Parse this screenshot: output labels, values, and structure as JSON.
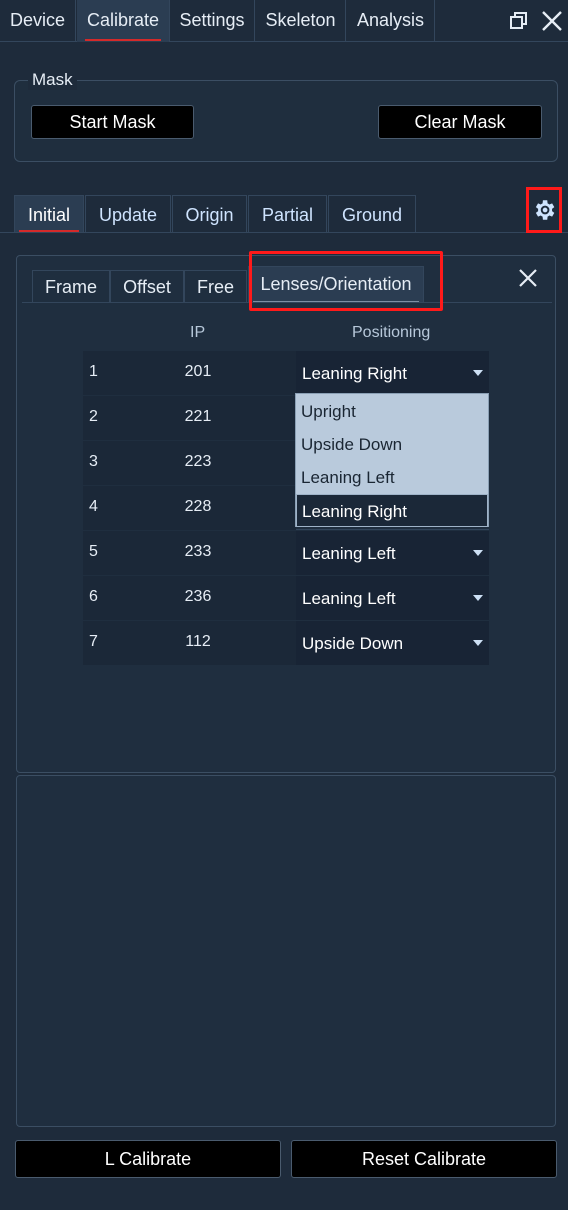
{
  "top_tabs": [
    "Device",
    "Calibrate",
    "Settings",
    "Skeleton",
    "Analysis"
  ],
  "mask": {
    "legend": "Mask",
    "start_label": "Start Mask",
    "clear_label": "Clear Mask"
  },
  "sub_tabs": [
    "Initial",
    "Update",
    "Origin",
    "Partial",
    "Ground"
  ],
  "inner_tabs": [
    "Frame",
    "Offset",
    "Free",
    "Lenses/Orientation"
  ],
  "table": {
    "headers": {
      "ip": "IP",
      "positioning": "Positioning"
    },
    "rows": [
      {
        "num": "1",
        "ip": "201",
        "positioning": "Leaning Right"
      },
      {
        "num": "2",
        "ip": "221",
        "positioning": ""
      },
      {
        "num": "3",
        "ip": "223",
        "positioning": ""
      },
      {
        "num": "4",
        "ip": "228",
        "positioning": ""
      },
      {
        "num": "5",
        "ip": "233",
        "positioning": "Leaning Left"
      },
      {
        "num": "6",
        "ip": "236",
        "positioning": "Leaning Left"
      },
      {
        "num": "7",
        "ip": "112",
        "positioning": "Upside Down"
      }
    ]
  },
  "dropdown": {
    "options": [
      "Upright",
      "Upside Down",
      "Leaning Left",
      "Leaning Right"
    ],
    "selected": "Leaning Right"
  },
  "footer": {
    "l_calibrate_label": "L Calibrate",
    "reset_label": "Reset Calibrate"
  },
  "colors": {
    "background": "#1b2838",
    "highlight": "#ff1a1a",
    "active_tab_underline": "#d42a2a"
  }
}
